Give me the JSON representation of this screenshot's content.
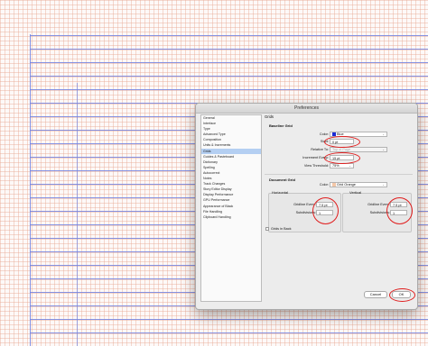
{
  "dialog": {
    "title": "Preferences",
    "nav_items": [
      {
        "label": "General"
      },
      {
        "label": "Interface"
      },
      {
        "label": "Type"
      },
      {
        "label": "Advanced Type"
      },
      {
        "label": "Composition"
      },
      {
        "label": "Units & Increments"
      },
      {
        "label": "Grids"
      },
      {
        "label": "Guides & Pasteboard"
      },
      {
        "label": "Dictionary"
      },
      {
        "label": "Spelling"
      },
      {
        "label": "Autocorrect"
      },
      {
        "label": "Notes"
      },
      {
        "label": "Track Changes"
      },
      {
        "label": "Story Editor Display"
      },
      {
        "label": "Display Performance"
      },
      {
        "label": "GPU Performance"
      },
      {
        "label": "Appearance of Black"
      },
      {
        "label": "File Handling"
      },
      {
        "label": "Clipboard Handling"
      }
    ],
    "selected_nav": "Grids",
    "section_title": "Grids",
    "baseline": {
      "title": "Baseline Grid",
      "color_label": "Color:",
      "color_value": "Blue",
      "color_swatch": "#1a2bd6",
      "start_label": "Start:",
      "start_value": "0 pt",
      "relative_label": "Relative To:",
      "relative_value": "Top of Page",
      "increment_label": "Increment Every:",
      "increment_value": "15 pt",
      "threshold_label": "View Threshold:",
      "threshold_value": "75%"
    },
    "document": {
      "title": "Document Grid",
      "color_label": "Color:",
      "color_value": "Grid Orange",
      "color_swatch": "#f3c7a8",
      "horizontal": {
        "title": "Horizontal",
        "gridline_label": "Gridline Every:",
        "gridline_value": "7.5 pt",
        "subdiv_label": "Subdivisions:",
        "subdiv_value": "1"
      },
      "vertical": {
        "title": "Vertical",
        "gridline_label": "Gridline Every:",
        "gridline_value": "7.5 pt",
        "subdiv_label": "Subdivisions:",
        "subdiv_value": "1"
      }
    },
    "grids_in_back_label": "Grids in Back",
    "cancel_label": "Cancel",
    "ok_label": "OK"
  },
  "colors": {
    "annotation_red": "#e01e1e",
    "selection_blue": "#b4cff2",
    "baseline_blue": "#7887e1",
    "grid_orange": "#e8aa96"
  }
}
